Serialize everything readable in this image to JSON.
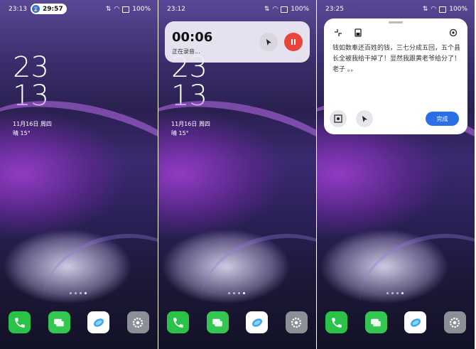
{
  "colors": {
    "accent_blue": "#2a6ee8",
    "record_red": "#e8453c",
    "phone_green": "#2bc24a"
  },
  "status_bar": {
    "signal": "⇅",
    "wifi": "wifi",
    "battery": "100%"
  },
  "panel1": {
    "time": "23:13",
    "timer": "29:57",
    "clock_hour": "23",
    "clock_min": "13",
    "date": "11月16日  周四",
    "weather": "晴  15°"
  },
  "panel2": {
    "time": "23:12",
    "clock_hour": "23",
    "clock_min": "13",
    "date": "11月16日  周四",
    "weather": "晴  15°",
    "recording": {
      "elapsed": "00:06",
      "status": "正在录音..."
    }
  },
  "panel3": {
    "time": "23:25",
    "note_text": "钱如数奉还百姓的钱，三七分成五回，五个县长全被我给干掉了！显然我跟黄老爷给分了！老子 。。",
    "done_label": "完成"
  },
  "dock_icons": [
    "phone-app",
    "messages-app",
    "browser-app",
    "settings-app"
  ]
}
